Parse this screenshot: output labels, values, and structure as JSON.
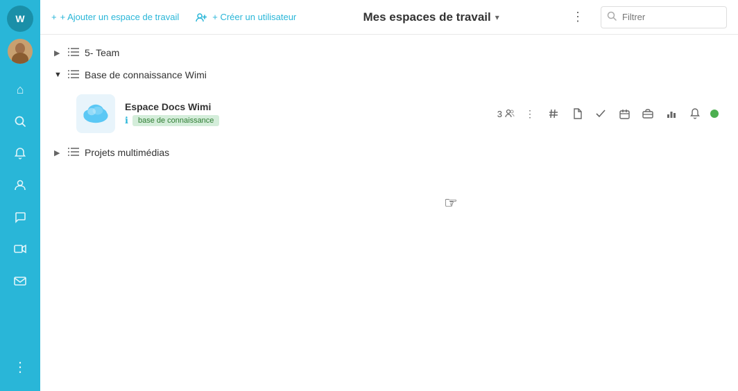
{
  "sidebar": {
    "logo_alt": "Wimi logo",
    "icons": [
      {
        "name": "home-icon",
        "glyph": "⌂"
      },
      {
        "name": "search-icon",
        "glyph": "🔍"
      },
      {
        "name": "bell-icon",
        "glyph": "🔔"
      },
      {
        "name": "contacts-icon",
        "glyph": "👤"
      },
      {
        "name": "chat-icon",
        "glyph": "💬"
      },
      {
        "name": "video-icon",
        "glyph": "📷"
      },
      {
        "name": "mail-icon",
        "glyph": "✉"
      }
    ],
    "bottom_icon": {
      "name": "more-icon",
      "glyph": "⋮"
    }
  },
  "topbar": {
    "add_workspace_label": "+ Ajouter un espace de travail",
    "create_user_label": "+ Créer un utilisateur",
    "title": "Mes espaces de travail",
    "filter_placeholder": "Filtrer"
  },
  "tree": {
    "item1": {
      "label": "5- Team",
      "collapsed": true
    },
    "item2": {
      "label": "Base de connaissance Wimi",
      "collapsed": false,
      "workspace": {
        "name": "Espace Docs Wimi",
        "badge": "base de connaissance",
        "members_count": "3"
      }
    },
    "item3": {
      "label": "Projets multimédias",
      "collapsed": true
    }
  },
  "workspace_actions": {
    "hash": "#",
    "file": "📄",
    "check": "✓",
    "calendar": "📅",
    "briefcase": "💼",
    "chart": "📊",
    "bell": "🔔"
  }
}
